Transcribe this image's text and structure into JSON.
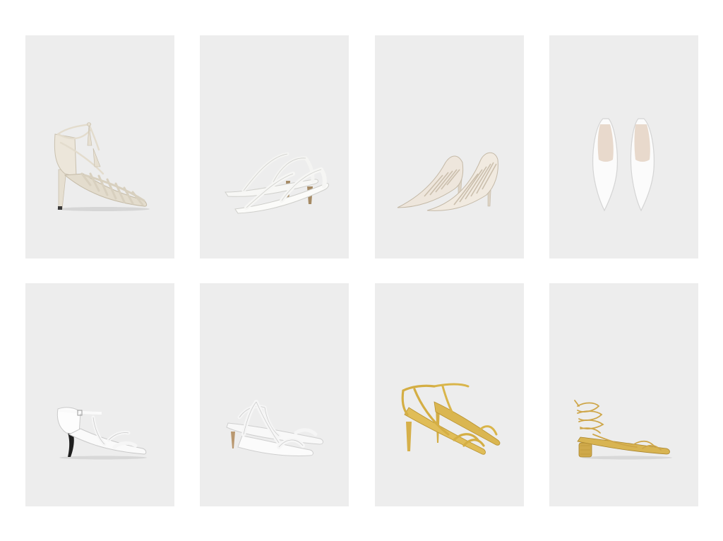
{
  "page": {
    "background": "#ffffff",
    "tile_background": "#ededed"
  },
  "products": [
    {
      "name": "lace-up-cage-heeled-sandal",
      "color": "#e9e3d6",
      "row": 1,
      "column": 1
    },
    {
      "name": "white-strappy-mid-heel-sandal",
      "color": "#f7f7f5",
      "row": 1,
      "column": 2
    },
    {
      "name": "cut-out-pointed-court-shoe",
      "color": "#eee6dc",
      "row": 1,
      "column": 3
    },
    {
      "name": "white-pointed-flat",
      "color": "#fbfbfb",
      "row": 1,
      "column": 4
    },
    {
      "name": "white-strap-sandal-black-heel",
      "color": "#fdfdfd",
      "row": 2,
      "column": 1
    },
    {
      "name": "white-slingback-kitten-heel-sandal",
      "color": "#fafafa",
      "row": 2,
      "column": 2
    },
    {
      "name": "gold-ankle-strap-stiletto-sandal",
      "color": "#d9b54a",
      "row": 2,
      "column": 3
    },
    {
      "name": "gold-lace-up-block-heel-sandal",
      "color": "#cfa94b",
      "row": 2,
      "column": 4
    }
  ]
}
